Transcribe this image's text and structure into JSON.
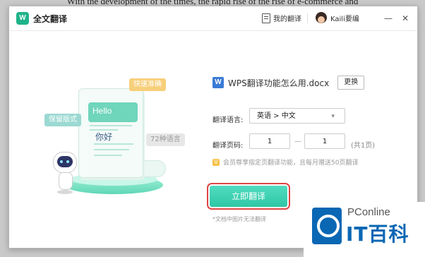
{
  "background_text": "With the development of the times, the rapid rise of the rise of e-commerce and",
  "app": {
    "logo": "W",
    "title": "全文翻译"
  },
  "header": {
    "my_translations": "我的翻译",
    "username": "Kaili要编",
    "minimize": "—",
    "close": "✕"
  },
  "illustration": {
    "hello": "Hello",
    "nihao": "你好",
    "bubble_fast": "快速准确",
    "bubble_format": "保留版式",
    "bubble_lang": "72种语言"
  },
  "file": {
    "icon_text": "W",
    "name": "WPS翻译功能怎么用.docx",
    "change_button": "更换"
  },
  "form": {
    "lang_label": "翻译语言:",
    "lang_value": "英语 > 中文",
    "page_label": "翻译页码:",
    "page_from": "1",
    "page_to": "1",
    "dash": "—",
    "page_total": "(共1页)"
  },
  "vip_note": "会员尊享指定页翻译功能，且每月赠送50页翻译",
  "translate_button": "立即翻译",
  "bottom_note": "*文档中图片无法翻译",
  "watermark": {
    "brand": "PConline",
    "site": "IT百科"
  },
  "colors": {
    "accent": "#2fc7a5",
    "highlight": "#e04545",
    "watermark": "#0a67b4"
  }
}
